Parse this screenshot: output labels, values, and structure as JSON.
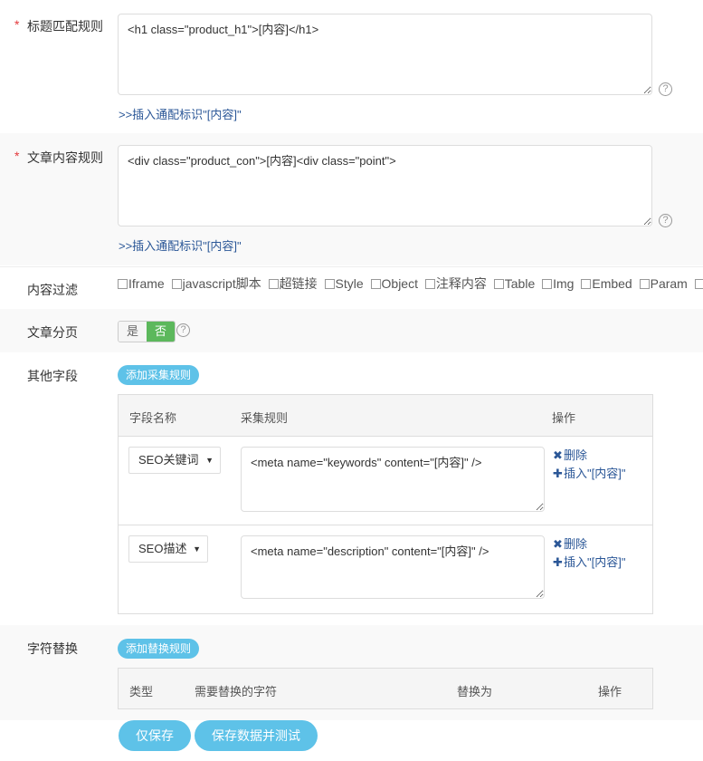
{
  "title_rule": {
    "label": "标题匹配规则",
    "required_mark": "*",
    "value": "<h1 class=\"product_h1\">[内容]</h1>",
    "insert_link": ">>插入通配标识\"[内容]\"",
    "help": "?"
  },
  "content_rule": {
    "label": "文章内容规则",
    "required_mark": "*",
    "value": "<div class=\"product_con\">[内容]<div class=\"point\">",
    "insert_link": ">>插入通配标识\"[内容]\"",
    "help": "?"
  },
  "content_filter": {
    "label": "内容过滤",
    "options": [
      "Iframe",
      "javascript脚本",
      "超链接",
      "Style",
      "Object",
      "注释内容",
      "Table",
      "Img",
      "Embed",
      "Param",
      ""
    ]
  },
  "pagination": {
    "label": "文章分页",
    "yes": "是",
    "no": "否",
    "selected": "否",
    "help": "?"
  },
  "other_fields": {
    "label": "其他字段",
    "add_button": "添加采集规则",
    "headers": {
      "name": "字段名称",
      "rule": "采集规则",
      "action": "操作"
    },
    "rows": [
      {
        "field": "SEO关键词",
        "rule": "<meta name=\"keywords\" content=\"[内容]\" />",
        "delete": "删除",
        "insert": "插入\"[内容]\""
      },
      {
        "field": "SEO描述",
        "rule": "<meta name=\"description\" content=\"[内容]\" />",
        "delete": "删除",
        "insert": "插入\"[内容]\""
      }
    ]
  },
  "replace": {
    "label": "字符替换",
    "add_button": "添加替换规则",
    "headers": {
      "type": "类型",
      "source": "需要替换的字符",
      "target": "替换为",
      "action": "操作"
    }
  },
  "buttons": {
    "save": "仅保存",
    "save_test": "保存数据并测试"
  },
  "colors": {
    "accent": "#5ec2e8",
    "toggle_on": "#5cb85c",
    "required": "#e4393c",
    "link": "#2b5797"
  }
}
